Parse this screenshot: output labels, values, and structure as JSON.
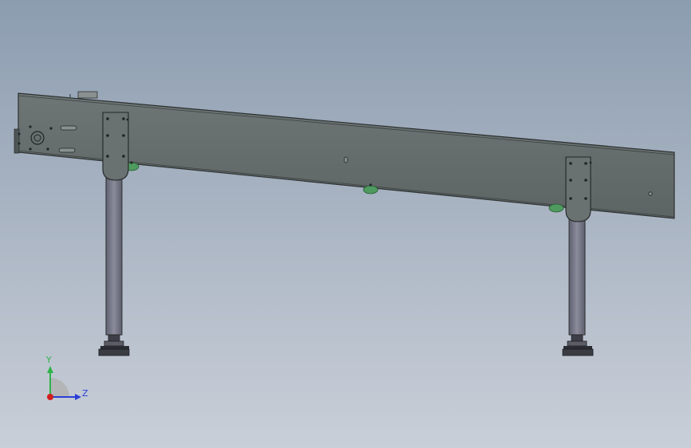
{
  "viewport": {
    "background_top": "#8c9db0",
    "background_bottom": "#c9cfd8"
  },
  "model": {
    "frame_color": "#646b6b",
    "frame_edge_color": "#2c3030",
    "leg_color": "#7e8090",
    "roller_color": "#4e9a5f"
  },
  "triad": {
    "y_label": "Y",
    "z_label": "Z",
    "y_color": "#2fb34a",
    "z_color": "#2c3fd6",
    "origin_color": "#d21e1e"
  }
}
